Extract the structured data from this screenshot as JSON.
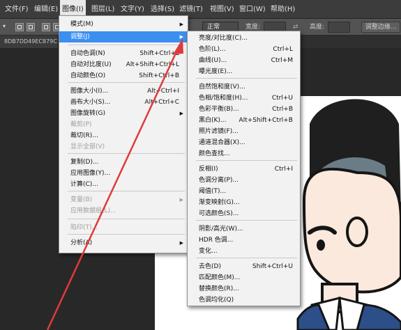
{
  "menubar": {
    "items": [
      "文件(F)",
      "编辑(E)",
      "图像(I)",
      "图层(L)",
      "文字(Y)",
      "选择(S)",
      "滤镜(T)",
      "视图(V)",
      "窗口(W)",
      "帮助(H)"
    ]
  },
  "options": {
    "mode_label": "正常",
    "width_label": "宽度:",
    "height_label": "高度:",
    "refine_button": "调整边缘..."
  },
  "document": {
    "tab_label": "8DB7DD49EC879C"
  },
  "image_menu": {
    "items": [
      {
        "label": "模式(M)",
        "shortcut": "",
        "submenu": true,
        "disabled": false
      },
      {
        "label": "调整(J)",
        "shortcut": "",
        "submenu": true,
        "disabled": false,
        "highlighted": true
      },
      {
        "label": "自动色调(N)",
        "shortcut": "Shift+Ctrl+L",
        "disabled": false
      },
      {
        "label": "自动对比度(U)",
        "shortcut": "Alt+Shift+Ctrl+L",
        "disabled": false
      },
      {
        "label": "自动颜色(O)",
        "shortcut": "Shift+Ctrl+B",
        "disabled": false
      },
      {
        "label": "图像大小(I)...",
        "shortcut": "Alt+Ctrl+I",
        "disabled": false
      },
      {
        "label": "画布大小(S)...",
        "shortcut": "Alt+Ctrl+C",
        "disabled": false
      },
      {
        "label": "图像旋转(G)",
        "shortcut": "",
        "submenu": true,
        "disabled": false
      },
      {
        "label": "裁剪(P)",
        "shortcut": "",
        "disabled": true
      },
      {
        "label": "裁切(R)...",
        "shortcut": "",
        "disabled": false
      },
      {
        "label": "显示全部(V)",
        "shortcut": "",
        "disabled": true
      },
      {
        "label": "复制(D)...",
        "shortcut": "",
        "disabled": false
      },
      {
        "label": "应用图像(Y)...",
        "shortcut": "",
        "disabled": false
      },
      {
        "label": "计算(C)...",
        "shortcut": "",
        "disabled": false
      },
      {
        "label": "变量(B)",
        "shortcut": "",
        "submenu": true,
        "disabled": true
      },
      {
        "label": "应用数据组(L)...",
        "shortcut": "",
        "disabled": true
      },
      {
        "label": "陷印(T)...",
        "shortcut": "",
        "disabled": true
      },
      {
        "label": "分析(A)",
        "shortcut": "",
        "submenu": true,
        "disabled": false
      }
    ]
  },
  "adjust_menu": {
    "items": [
      {
        "label": "亮度/对比度(C)...",
        "shortcut": ""
      },
      {
        "label": "色阶(L)...",
        "shortcut": "Ctrl+L"
      },
      {
        "label": "曲线(U)...",
        "shortcut": "Ctrl+M"
      },
      {
        "label": "曝光度(E)...",
        "shortcut": ""
      },
      {
        "label": "自然饱和度(V)...",
        "shortcut": ""
      },
      {
        "label": "色相/饱和度(H)...",
        "shortcut": "Ctrl+U"
      },
      {
        "label": "色彩平衡(B)...",
        "shortcut": "Ctrl+B"
      },
      {
        "label": "黑白(K)...",
        "shortcut": "Alt+Shift+Ctrl+B"
      },
      {
        "label": "照片滤镜(F)...",
        "shortcut": ""
      },
      {
        "label": "通道混合器(X)...",
        "shortcut": ""
      },
      {
        "label": "颜色查找...",
        "shortcut": ""
      },
      {
        "label": "反相(I)",
        "shortcut": "Ctrl+I"
      },
      {
        "label": "色调分离(P)...",
        "shortcut": ""
      },
      {
        "label": "阈值(T)...",
        "shortcut": ""
      },
      {
        "label": "渐变映射(G)...",
        "shortcut": ""
      },
      {
        "label": "可选颜色(S)...",
        "shortcut": ""
      },
      {
        "label": "阴影/高光(W)...",
        "shortcut": ""
      },
      {
        "label": "HDR 色调...",
        "shortcut": ""
      },
      {
        "label": "变化...",
        "shortcut": ""
      },
      {
        "label": "去色(D)",
        "shortcut": "Shift+Ctrl+U"
      },
      {
        "label": "匹配颜色(M)...",
        "shortcut": ""
      },
      {
        "label": "替换颜色(R)...",
        "shortcut": ""
      },
      {
        "label": "色调均化(Q)",
        "shortcut": ""
      }
    ]
  },
  "colors": {
    "highlight": "#3b8ff0",
    "arrow": "#e03a3a",
    "menubar": "#3c3c3c",
    "menu_bg": "#f2f2f2"
  }
}
